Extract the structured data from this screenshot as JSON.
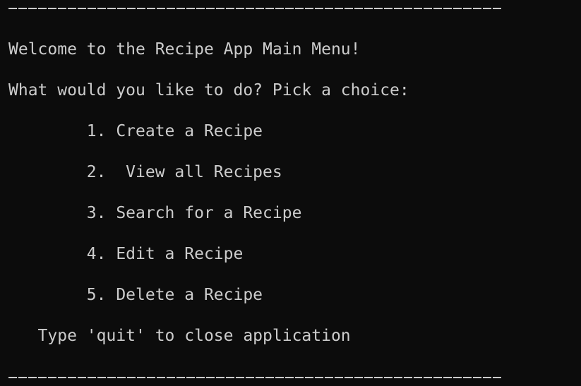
{
  "menu": {
    "welcome": "Welcome to the Recipe App Main Menu!",
    "prompt": "What would you like to do? Pick a choice:",
    "options": [
      "        1. Create a Recipe",
      "        2.  View all Recipes",
      "        3. Search for a Recipe",
      "        4. Edit a Recipe",
      "        5. Delete a Recipe"
    ],
    "quit_hint": "   Type 'quit' to close application"
  },
  "colors": {
    "background": "#0c0c0c",
    "text": "#cccccc"
  }
}
